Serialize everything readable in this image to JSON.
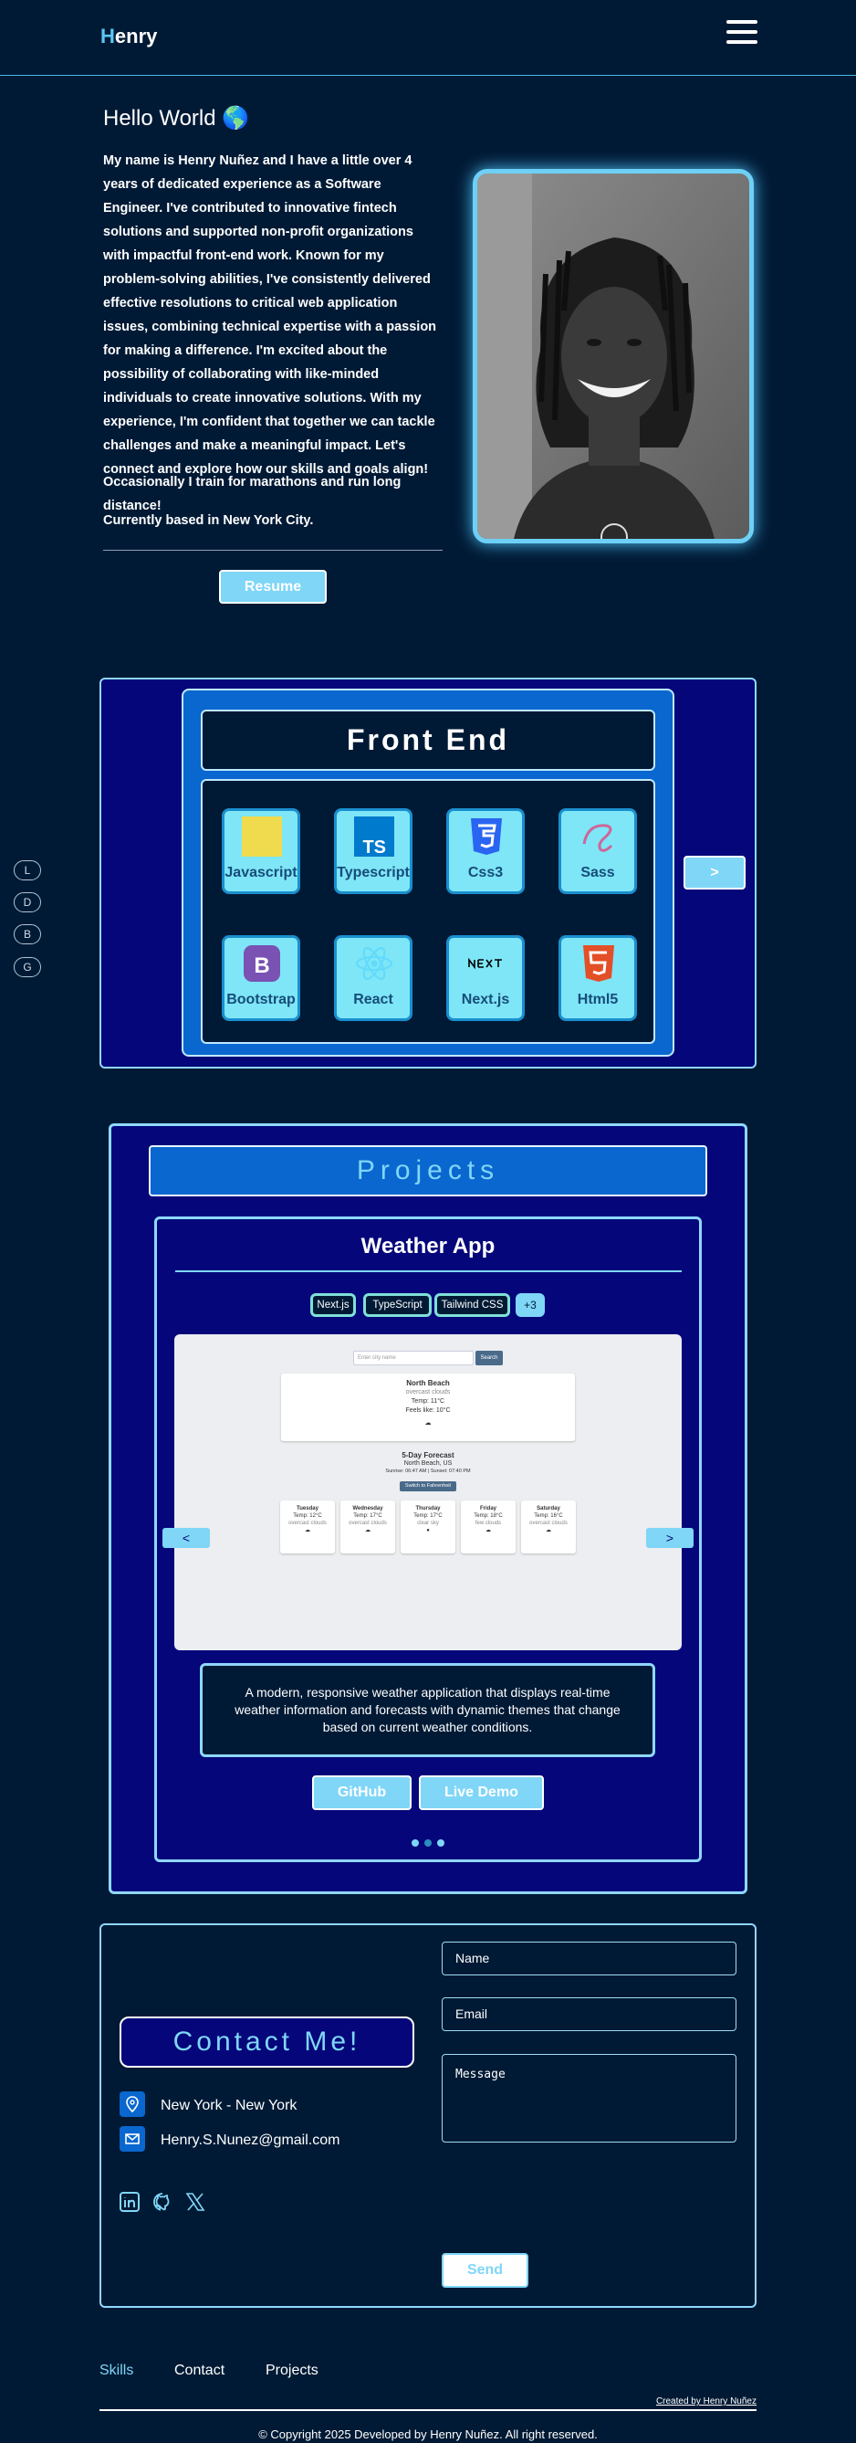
{
  "header": {
    "logo_first": "H",
    "logo_rest": "enry",
    "menu_icon": "hamburger-icon"
  },
  "hero": {
    "greeting": "Hello World 🌎",
    "bio": "My name is Henry Nuñez and I have a little over 4 years of dedicated experience as a Software Engineer. I've contributed to innovative fintech solutions and supported non-profit organizations with impactful front-end work. Known for my problem-solving abilities, I've consistently delivered effective resolutions to critical web application issues, combining technical expertise with a passion for making a difference. I'm excited about the possibility of collaborating with like-minded individuals to create innovative solutions. With my experience, I'm confident that together we can tackle challenges and make a meaningful impact. Let's connect and explore how our skills and goals align!",
    "hobby": "Occasionally I train for marathons and run long distance!",
    "location": "Currently based in New York City.",
    "resume_label": "Resume"
  },
  "side_nav": [
    "L",
    "D",
    "B",
    "G"
  ],
  "skills": {
    "title": "Front End",
    "next_label": ">",
    "items": [
      {
        "label": "Javascript",
        "icon": "javascript-icon"
      },
      {
        "label": "Typescript",
        "icon": "typescript-icon"
      },
      {
        "label": "Css3",
        "icon": "css3-icon"
      },
      {
        "label": "Sass",
        "icon": "sass-icon"
      },
      {
        "label": "Bootstrap",
        "icon": "bootstrap-icon"
      },
      {
        "label": "React",
        "icon": "react-icon"
      },
      {
        "label": "Next.js",
        "icon": "nextjs-icon"
      },
      {
        "label": "Html5",
        "icon": "html5-icon"
      }
    ]
  },
  "projects": {
    "title": "Projects",
    "name": "Weather App",
    "tags": [
      "Next.js",
      "TypeScript",
      "Tailwind CSS"
    ],
    "more_tags": "+3",
    "prev_label": "<",
    "next_label": ">",
    "description": "A modern, responsive weather application that displays real-time weather information and forecasts with dynamic themes that change based on current weather conditions.",
    "github_label": "GitHub",
    "demo_label": "Live Demo",
    "screenshot": {
      "search_placeholder": "Enter city name",
      "search_button": "Search",
      "city": "North Beach",
      "condition": "overcast clouds",
      "temp": "Temp: 11°C",
      "feels": "Feels like: 10°C",
      "forecast_title": "5-Day Forecast",
      "forecast_city": "North Beach, US",
      "sun_times": "Sunrise: 06:47 AM | Sunset: 07:40 PM",
      "switch_label": "Switch to Fahrenheit",
      "days": [
        {
          "day": "Tuesday",
          "temp": "Temp: 12°C",
          "desc": "overcast clouds"
        },
        {
          "day": "Wednesday",
          "temp": "Temp: 17°C",
          "desc": "overcast clouds"
        },
        {
          "day": "Thursday",
          "temp": "Temp: 17°C",
          "desc": "clear sky"
        },
        {
          "day": "Friday",
          "temp": "Temp: 18°C",
          "desc": "few clouds"
        },
        {
          "day": "Saturday",
          "temp": "Temp: 16°C",
          "desc": "overcast clouds"
        }
      ]
    }
  },
  "contact": {
    "title": "Contact Me!",
    "location": "New York - New York",
    "email": "Henry.S.Nunez@gmail.com",
    "name_placeholder": "Name",
    "email_placeholder": "Email",
    "message_placeholder": "Message",
    "send_label": "Send"
  },
  "footer": {
    "nav": [
      "Skills",
      "Contact",
      "Projects"
    ],
    "credit": "Created by Henry Nuñez",
    "copyright": "© Copyright 2025 Developed by Henry Nuñez. All right reserved."
  },
  "colors": {
    "background": "#001a35",
    "accent": "#7fd6f7",
    "panel": "#05067a",
    "blue": "#0a67cf"
  }
}
